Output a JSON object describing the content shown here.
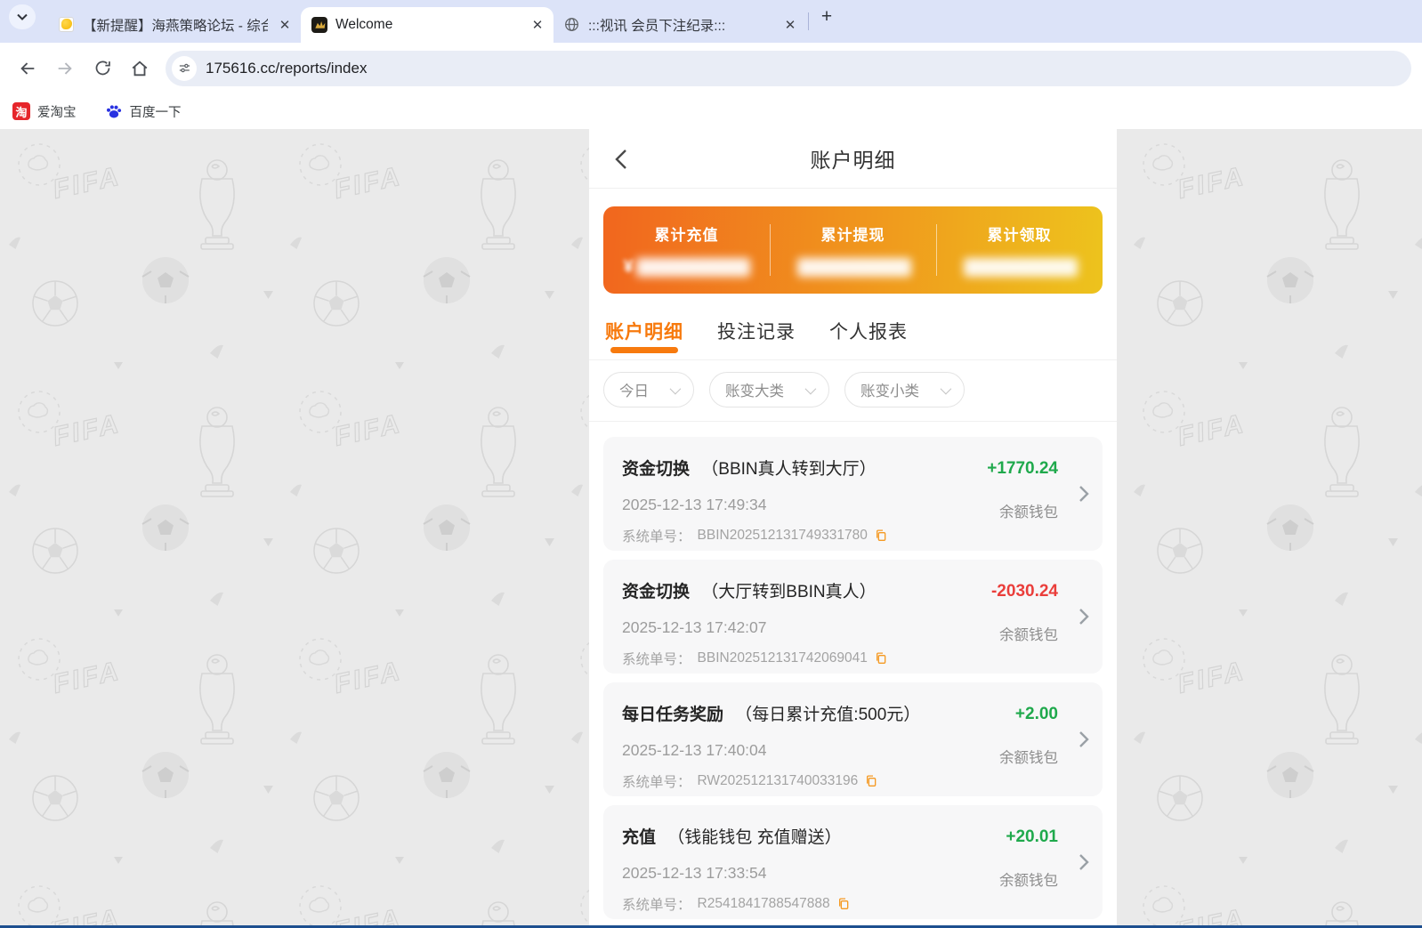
{
  "colors": {
    "accent_orange": "#f77a0e",
    "card_gradient_start": "#f1661e",
    "card_gradient_end": "#edc31d",
    "amount_positive": "#1fa94c",
    "amount_negative": "#ea3e3b",
    "tabstrip_bg": "#dce3f8"
  },
  "browser": {
    "tabs": [
      {
        "title": "【新提醒】海燕策略论坛 - 综合",
        "state": "",
        "favicon": "yellow-doc"
      },
      {
        "title": "Welcome",
        "state": "active",
        "favicon": "gold-emblem"
      },
      {
        "title": ":::视讯 会员下注纪录:::",
        "state": "",
        "favicon": "globe"
      }
    ],
    "new_tab_label": "+",
    "url": "175616.cc/reports/index",
    "bookmarks": [
      {
        "label": "爱淘宝",
        "icon": "taobao",
        "icon_char": "淘"
      },
      {
        "label": "百度一下",
        "icon": "baidu",
        "icon_char": ""
      }
    ]
  },
  "page": {
    "title": "账户明细",
    "summary": {
      "items": [
        {
          "label": "累计充值",
          "masked_prefix": "¥"
        },
        {
          "label": "累计提现",
          "masked_prefix": ""
        },
        {
          "label": "累计领取",
          "masked_prefix": ""
        }
      ]
    },
    "tabs": [
      {
        "label": "账户明细",
        "state": "active"
      },
      {
        "label": "投注记录",
        "state": ""
      },
      {
        "label": "个人报表",
        "state": ""
      }
    ],
    "filters": [
      {
        "label": "今日"
      },
      {
        "label": "账变大类"
      },
      {
        "label": "账变小类"
      }
    ],
    "order_label": "系统单号：",
    "transactions": [
      {
        "title": "资金切换",
        "subtitle": "（BBIN真人转到大厅）",
        "amount": "+1770.24",
        "amount_color": "pos",
        "datetime": "2025-12-13 17:49:34",
        "order_no": "BBIN202512131749331780",
        "wallet": "余额钱包"
      },
      {
        "title": "资金切换",
        "subtitle": "（大厅转到BBIN真人）",
        "amount": "-2030.24",
        "amount_color": "neg",
        "datetime": "2025-12-13 17:42:07",
        "order_no": "BBIN202512131742069041",
        "wallet": "余额钱包"
      },
      {
        "title": "每日任务奖励",
        "subtitle": "（每日累计充值:500元）",
        "amount": "+2.00",
        "amount_color": "pos",
        "datetime": "2025-12-13 17:40:04",
        "order_no": "RW202512131740033196",
        "wallet": "余额钱包"
      },
      {
        "title": "充值",
        "subtitle": "（钱能钱包 充值赠送）",
        "amount": "+20.01",
        "amount_color": "pos",
        "datetime": "2025-12-13 17:33:54",
        "order_no": "R2541841788547888",
        "wallet": "余额钱包"
      }
    ]
  }
}
